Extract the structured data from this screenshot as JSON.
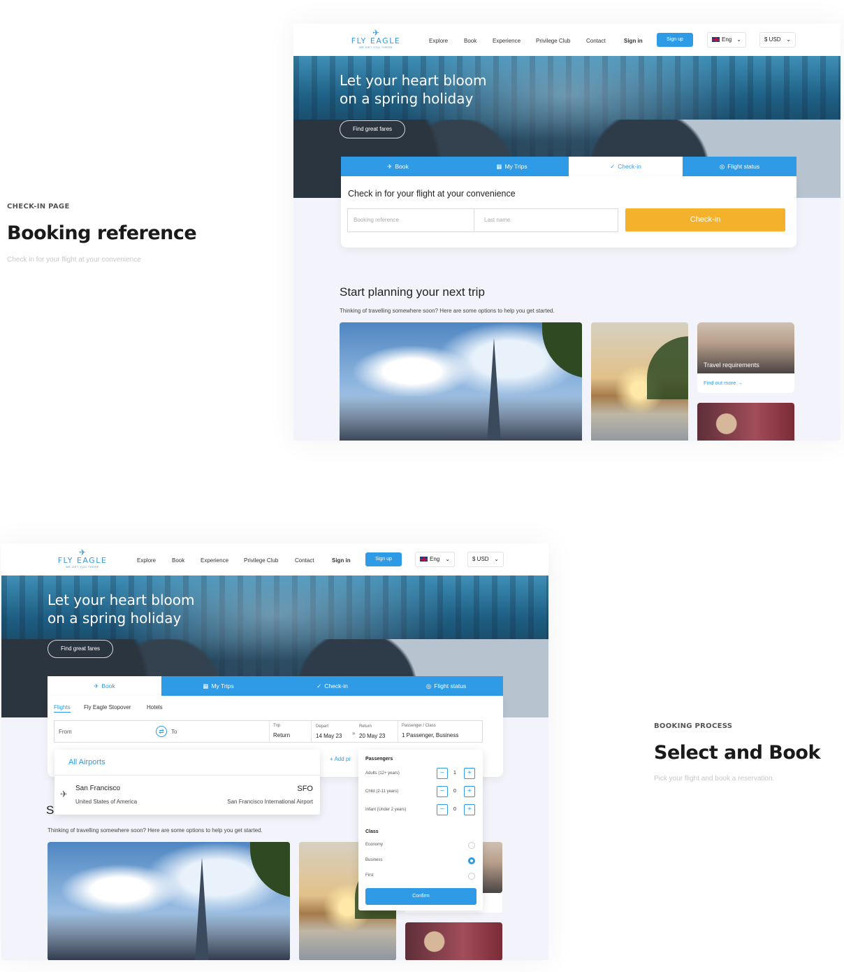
{
  "colors": {
    "accent": "#2f9be6",
    "cta": "#f4b22c",
    "bg": "#f3f4fb"
  },
  "sections": {
    "checkin": {
      "label": "CHECK-IN PAGE",
      "title": "Booking reference",
      "subtitle": "Check in for your flight at your convenience"
    },
    "booking": {
      "label": "BOOKING PROCESS",
      "title": "Select and Book",
      "subtitle": "Pick your flight and book a reservation."
    }
  },
  "nav": {
    "logo_name": "FLY EAGLE",
    "logo_tag": "WE GET YOU THERE",
    "items": [
      "Explore",
      "Book",
      "Experience",
      "Privilege Club",
      "Contact"
    ],
    "signin": "Sign in",
    "signup": "Sign up",
    "language": "Eng",
    "currency": "$ USD"
  },
  "hero": {
    "title_line1": "Let your heart bloom",
    "title_line2": "on a spring holiday",
    "cta": "Find great fares"
  },
  "tabs": [
    {
      "label": "Book",
      "icon": "plane-icon"
    },
    {
      "label": "My Trips",
      "icon": "calendar-icon"
    },
    {
      "label": "Check-in",
      "icon": "check-circle-icon"
    },
    {
      "label": "Flight status",
      "icon": "location-icon"
    }
  ],
  "checkin_card": {
    "heading": "Check in for your flight at your convenience",
    "booking_placeholder": "Booking reference",
    "lastname_placeholder": "Last name",
    "button": "Check-in"
  },
  "planning": {
    "heading": "Start planning your next trip",
    "sub": "Thinking of travelling somewhere soon? Here are some options to help you get started.",
    "travel_caption": "Travel requirements",
    "find_more": "Find out more →"
  },
  "booking_form": {
    "subtabs": [
      "Flights",
      "Fly Eagle Stopover",
      "Hotels"
    ],
    "from": "From",
    "to": "To",
    "trip_label": "Trip",
    "trip_value": "Return",
    "depart_label": "Depart",
    "depart_value": "14 May 23",
    "return_label": "Return",
    "return_value": "20 May 23",
    "pax_label": "Passenger / Class",
    "pax_value": "1 Passenger, Business",
    "add_promo": "+  Add pr"
  },
  "airports": {
    "all": "All Airports",
    "city": "San Francisco",
    "code": "SFO",
    "country": "United States of America",
    "airport": "San Francisco International Airport"
  },
  "passengers": {
    "heading": "Passengers",
    "rows": [
      {
        "label": "Adults (12+ years)",
        "count": "1"
      },
      {
        "label": "Child (2-11 years)",
        "count": "0"
      },
      {
        "label": "Infant (Under 2 years)",
        "count": "0"
      }
    ],
    "class_heading": "Class",
    "classes": [
      {
        "label": "Economy",
        "selected": false
      },
      {
        "label": "Business",
        "selected": true
      },
      {
        "label": "First",
        "selected": false
      }
    ],
    "confirm": "Confirm"
  },
  "truncated_heading": "S"
}
